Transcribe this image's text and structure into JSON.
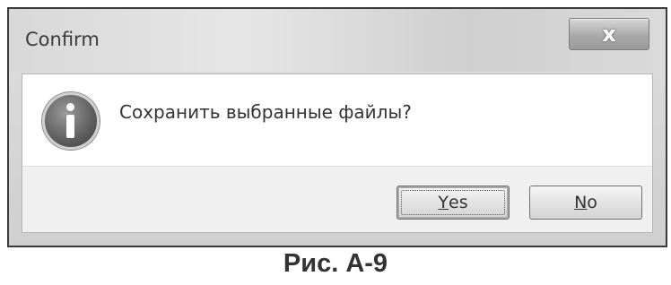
{
  "window": {
    "title": "Confirm",
    "close_glyph": "x"
  },
  "dialog": {
    "icon": "info-icon",
    "message": "Сохранить выбранные файлы?"
  },
  "buttons": {
    "yes": {
      "mnemonic": "Y",
      "rest": "es"
    },
    "no": {
      "mnemonic": "N",
      "rest": "o"
    }
  },
  "caption": "Рис. А-9"
}
